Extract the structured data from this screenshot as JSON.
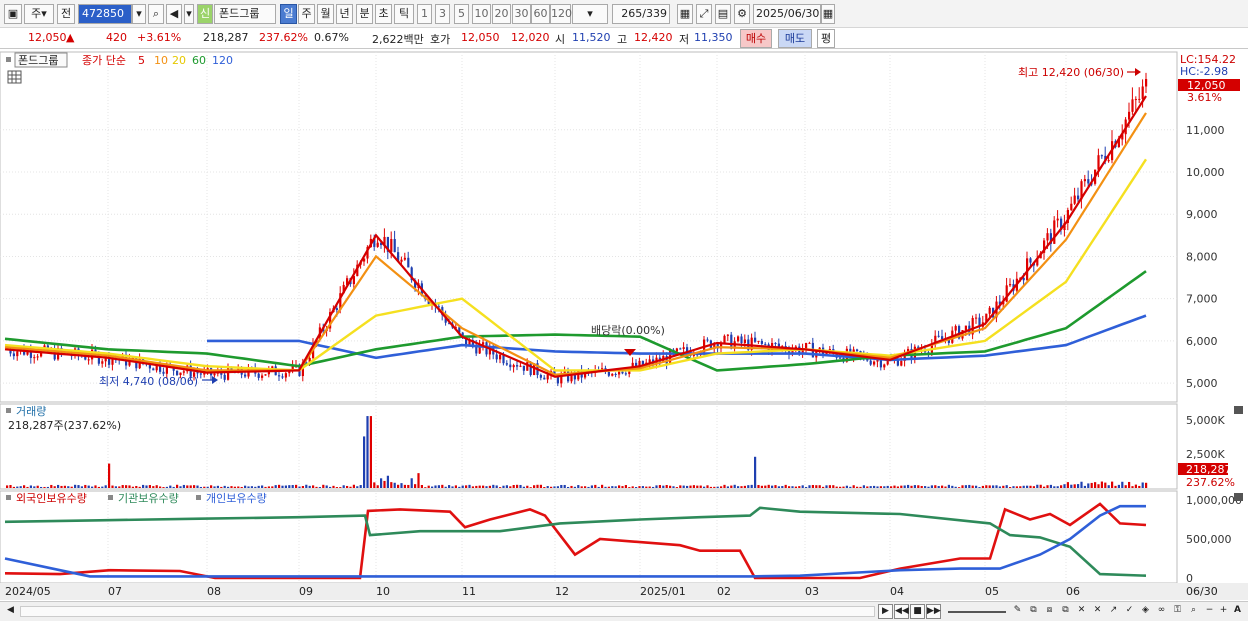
{
  "toolbar": {
    "market": "주",
    "prev_btn": "전",
    "stock_code": "472850",
    "new_badge": "신",
    "stock_name": "폰드그룹",
    "period_buttons": [
      "일",
      "주",
      "월",
      "년",
      "분",
      "초",
      "틱"
    ],
    "interval_buttons": [
      "1",
      "3",
      "5",
      "10",
      "20",
      "30",
      "60",
      "120"
    ],
    "count": "265",
    "total": "/339",
    "date": "2025/06/30"
  },
  "quote": {
    "price": "12,050",
    "change": "420",
    "change_pct": "+3.61%",
    "volume": "218,287",
    "volume_ratio": "237.62%",
    "turnover": "0.67%",
    "amount": "2,622백만",
    "ask_label": "호가",
    "ask": "12,050",
    "bid": "12,020",
    "open_label": "시",
    "open": "11,520",
    "high_label": "고",
    "high": "12,420",
    "low_label": "저",
    "low": "11,350",
    "buy_btn": "매수",
    "sell_btn": "매도",
    "eval_btn": "평"
  },
  "legend": {
    "name": "폰드그룹",
    "ma_title": "종가 단순",
    "ma5": "5",
    "ma10": "10",
    "ma20": "20",
    "ma60": "60",
    "ma120": "120"
  },
  "price_panel": {
    "max_label": "최고 12,420 (06/30)",
    "min_label": "최저 4,740 (08/06)",
    "dividend_label": "배당락(0.00%)",
    "lc": "LC:154.22",
    "hc": "HC:-2.98",
    "last_price": "12,050",
    "last_pct": "3.61%",
    "y_ticks": [
      "11,000",
      "10,000",
      "9,000",
      "8,000",
      "7,000",
      "6,000",
      "5,000"
    ]
  },
  "volume_panel": {
    "title": "거래량",
    "value": "218,287주(237.62%)",
    "y_ticks": [
      "5,000K",
      "2,500K"
    ],
    "last_volume": "218,287",
    "last_pct": "237.62%"
  },
  "holdings_panel": {
    "series": [
      "외국인보유수량",
      "기관보유수량",
      "개인보유수량"
    ],
    "y_ticks": [
      "1,000,000",
      "500,000",
      "0"
    ]
  },
  "x_axis": [
    "2024/05",
    "07",
    "08",
    "09",
    "10",
    "11",
    "12",
    "2025/01",
    "02",
    "03",
    "04",
    "05",
    "06",
    "06/30"
  ],
  "colors": {
    "up": "#e00000",
    "down": "#1f3fb0",
    "ma5": "#d40000",
    "ma10": "#f39012",
    "ma20": "#f5e020",
    "ma60": "#1e9a2e",
    "ma120": "#2f5fd8",
    "foreign": "#e01010",
    "institution": "#2e8a5a",
    "individual": "#2f5fd8"
  },
  "chart_data": {
    "type": "line",
    "title": "",
    "x": [
      "2024/05",
      "07",
      "08",
      "09",
      "10",
      "11",
      "12",
      "2025/01",
      "02",
      "03",
      "04",
      "05",
      "06",
      "06/30"
    ],
    "series": [
      {
        "name": "종가",
        "values": [
          5800,
          5600,
          5200,
          5300,
          8600,
          6000,
          5100,
          5400,
          6000,
          5800,
          5500,
          6500,
          9000,
          12050
        ]
      },
      {
        "name": "5",
        "values": [
          5800,
          5600,
          5250,
          5300,
          8500,
          6100,
          5150,
          5400,
          5950,
          5800,
          5550,
          6400,
          8800,
          11800
        ]
      },
      {
        "name": "10",
        "values": [
          5850,
          5650,
          5300,
          5300,
          8000,
          6300,
          5200,
          5350,
          5850,
          5800,
          5600,
          6300,
          8400,
          11400
        ]
      },
      {
        "name": "20",
        "values": [
          5900,
          5700,
          5400,
          5300,
          6600,
          7000,
          5300,
          5300,
          5700,
          5800,
          5650,
          6000,
          7400,
          10300
        ]
      },
      {
        "name": "60",
        "values": [
          6050,
          5800,
          5700,
          5400,
          5800,
          6100,
          6150,
          6100,
          5300,
          5450,
          5650,
          5750,
          6300,
          7650
        ]
      },
      {
        "name": "120",
        "values": [
          null,
          null,
          null,
          6000,
          5600,
          5900,
          5750,
          5700,
          5700,
          5700,
          5550,
          5650,
          5900,
          6600
        ]
      }
    ],
    "ylim": [
      4600,
      12700
    ]
  }
}
